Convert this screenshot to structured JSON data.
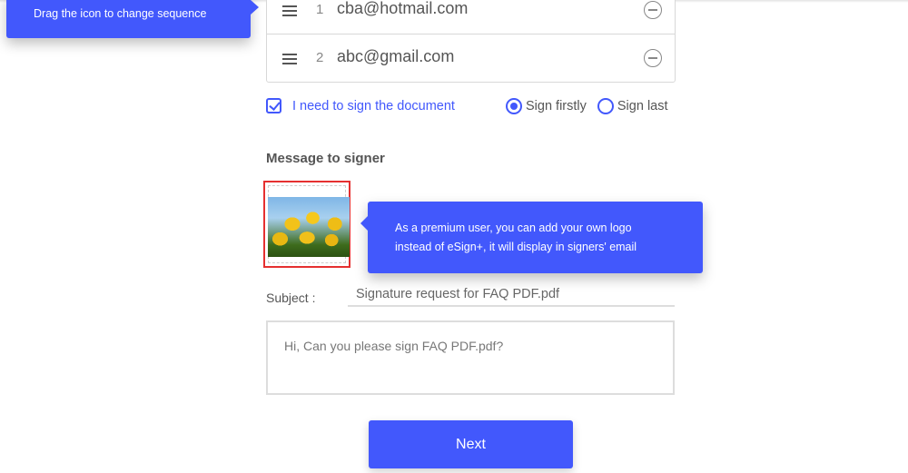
{
  "tooltips": {
    "drag": "Drag the icon to change sequence",
    "logo_line1": "As a premium user, you can add your own logo",
    "logo_line2": "instead of eSign+, it will display in signers' email"
  },
  "signers": [
    {
      "order": "1",
      "email": "cba@hotmail.com"
    },
    {
      "order": "2",
      "email": "abc@gmail.com"
    }
  ],
  "sign_option": {
    "checkbox_label": "I need to sign the document",
    "checked": true,
    "radio_options": [
      {
        "label": "Sign firstly",
        "selected": true
      },
      {
        "label": "Sign last",
        "selected": false
      }
    ]
  },
  "message": {
    "section_title": "Message to signer",
    "logo_icon": "tulips-image",
    "subject_label": "Subject :",
    "subject_value": "Signature request for FAQ PDF.pdf",
    "body_value": "Hi, Can you please sign FAQ PDF.pdf?"
  },
  "actions": {
    "next_label": "Next"
  },
  "colors": {
    "accent": "#4258fc",
    "highlight_border": "#e53030"
  }
}
